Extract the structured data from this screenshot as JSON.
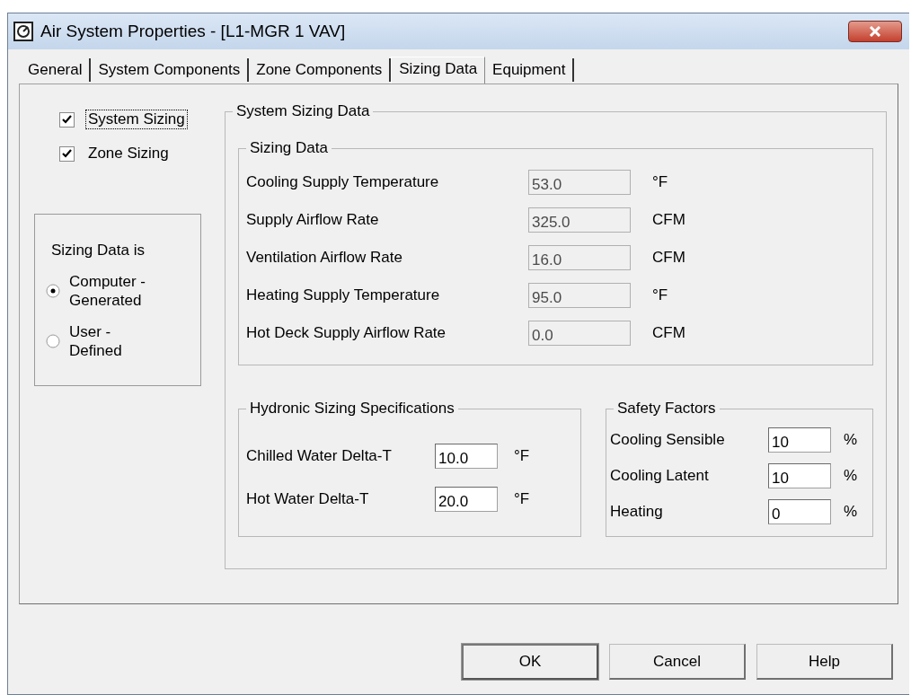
{
  "window": {
    "title": "Air System Properties - [L1-MGR 1 VAV]"
  },
  "tabs": [
    {
      "label": "General",
      "selected": false
    },
    {
      "label": "System Components",
      "selected": false
    },
    {
      "label": "Zone Components",
      "selected": false
    },
    {
      "label": "Sizing Data",
      "selected": true
    },
    {
      "label": "Equipment",
      "selected": false
    }
  ],
  "checkboxes": [
    {
      "label": "System Sizing",
      "checked": true,
      "focused": true
    },
    {
      "label": "Zone Sizing",
      "checked": true,
      "focused": false
    }
  ],
  "sizing_source": {
    "title": "Sizing Data is",
    "options": [
      {
        "label": "Computer - Generated",
        "selected": true
      },
      {
        "label": "User - Defined",
        "selected": false
      }
    ]
  },
  "system_sizing_data": {
    "title": "System Sizing Data",
    "sizing_data": {
      "title": "Sizing Data",
      "rows": [
        {
          "label": "Cooling Supply Temperature",
          "value": "53.0",
          "unit": "°F",
          "disabled": true
        },
        {
          "label": "Supply Airflow Rate",
          "value": "325.0",
          "unit": "CFM",
          "disabled": true
        },
        {
          "label": "Ventilation Airflow Rate",
          "value": "16.0",
          "unit": "CFM",
          "disabled": true
        },
        {
          "label": "Heating Supply Temperature",
          "value": "95.0",
          "unit": "°F",
          "disabled": true
        },
        {
          "label": "Hot Deck Supply Airflow Rate",
          "value": "0.0",
          "unit": "CFM",
          "disabled": true
        }
      ]
    },
    "hydronic": {
      "title": "Hydronic Sizing Specifications",
      "rows": [
        {
          "label": "Chilled Water Delta-T",
          "value": "10.0",
          "unit": "°F",
          "disabled": false
        },
        {
          "label": "Hot Water Delta-T",
          "value": "20.0",
          "unit": "°F",
          "disabled": false
        }
      ]
    },
    "safety_factors": {
      "title": "Safety Factors",
      "rows": [
        {
          "label": "Cooling Sensible",
          "value": "10",
          "unit": "%",
          "disabled": false
        },
        {
          "label": "Cooling Latent",
          "value": "10",
          "unit": "%",
          "disabled": false
        },
        {
          "label": "Heating",
          "value": "0",
          "unit": "%",
          "disabled": false
        }
      ]
    }
  },
  "buttons": [
    {
      "label": "OK",
      "default": true
    },
    {
      "label": "Cancel",
      "default": false
    },
    {
      "label": "Help",
      "default": false
    }
  ]
}
